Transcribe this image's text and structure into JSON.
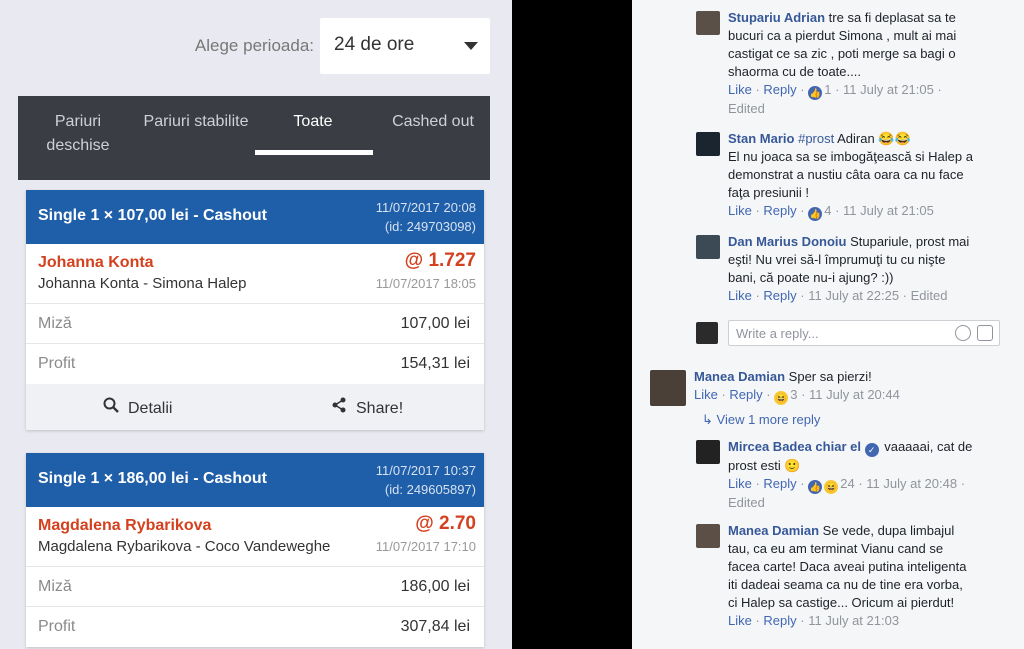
{
  "betting": {
    "period_label": "Alege perioada:",
    "period_value": "24 de ore",
    "tabs": [
      {
        "label": "Pariuri deschise"
      },
      {
        "label": "Pariuri stabilite"
      },
      {
        "label": "Toate"
      },
      {
        "label": "Cashed out"
      }
    ],
    "bets": [
      {
        "title": "Single 1 × 107,00 lei - Cashout",
        "date": "11/07/2017 20:08",
        "id": "(id: 249703098)",
        "player": "Johanna Konta",
        "match": "Johanna Konta - Simona Halep",
        "odds": "@ 1.727",
        "match_time": "11/07/2017 18:05",
        "stake_label": "Miză",
        "stake": "107,00 lei",
        "profit_label": "Profit",
        "profit": "154,31 lei",
        "details_label": "Detalii",
        "share_label": "Share!"
      },
      {
        "title": "Single 1 × 186,00 lei - Cashout",
        "date": "11/07/2017 10:37",
        "id": "(id: 249605897)",
        "player": "Magdalena Rybarikova",
        "match": "Magdalena Rybarikova - Coco Vandeweghe",
        "odds": "@ 2.70",
        "match_time": "11/07/2017 17:10",
        "stake_label": "Miză",
        "stake": "186,00 lei",
        "profit_label": "Profit",
        "profit": "307,84 lei"
      }
    ]
  },
  "comments": [
    {
      "author": "Stupariu Adrian",
      "text_lines": [
        "tre sa fi deplasat sa te",
        "bucuri ca a pierdut Simona , mult ai mai",
        "castigat ce sa zic , poti merge sa bagi o",
        "shaorma cu de toate...."
      ],
      "like": "Like",
      "reply": "Reply",
      "reactions": "1",
      "time": "11 July at 21:05",
      "edited": "Edited"
    },
    {
      "author": "Stan Mario",
      "hashtag": "#prost",
      "first_text": "Adiran 😂😂",
      "text_lines": [
        "El nu joaca sa se imbogăţească si Halep a",
        "demonstrat a nustiu câta oara ca nu face",
        "faţa presiunii !"
      ],
      "like": "Like",
      "reply": "Reply",
      "reactions": "4",
      "time": "11 July at 21:05"
    },
    {
      "author": "Dan Marius Donoiu",
      "first_text": "Stupariule, prost mai",
      "text_lines": [
        "eşti! Nu vrei să-l împrumuţi tu cu nişte",
        "bani, că poate nu-i ajung? :))"
      ],
      "like": "Like",
      "reply": "Reply",
      "time": "11 July at 22:25",
      "edited": "Edited"
    },
    {
      "placeholder": "Write a reply..."
    },
    {
      "author": "Manea Damian",
      "first_text": "Sper sa pierzi!",
      "like": "Like",
      "reply": "Reply",
      "reactions": "3",
      "time": "11 July at 20:44",
      "more_replies": "View 1 more reply"
    },
    {
      "author": "Mircea Badea chiar el",
      "first_text": "vaaaaai, cat de",
      "text_lines": [
        "prost esti 🙂"
      ],
      "like": "Like",
      "reply": "Reply",
      "reactions": "24",
      "time": "11 July at 20:48",
      "edited": "Edited"
    },
    {
      "author": "Manea Damian",
      "first_text": "Se vede, dupa limbajul",
      "text_lines": [
        "tau, ca eu am terminat Vianu cand se",
        "facea carte! Daca aveai putina inteligenta",
        "iti dadeai seama ca nu de tine era vorba,",
        "ci Halep sa castige... Oricum ai pierdut!"
      ],
      "like": "Like",
      "reply": "Reply",
      "time": "11 July at 21:03"
    }
  ],
  "colors": {
    "bet_header": "#1f5ea8",
    "odds": "#d4411e",
    "fb_link": "#365899",
    "tabs_bg": "#3a3d44"
  }
}
